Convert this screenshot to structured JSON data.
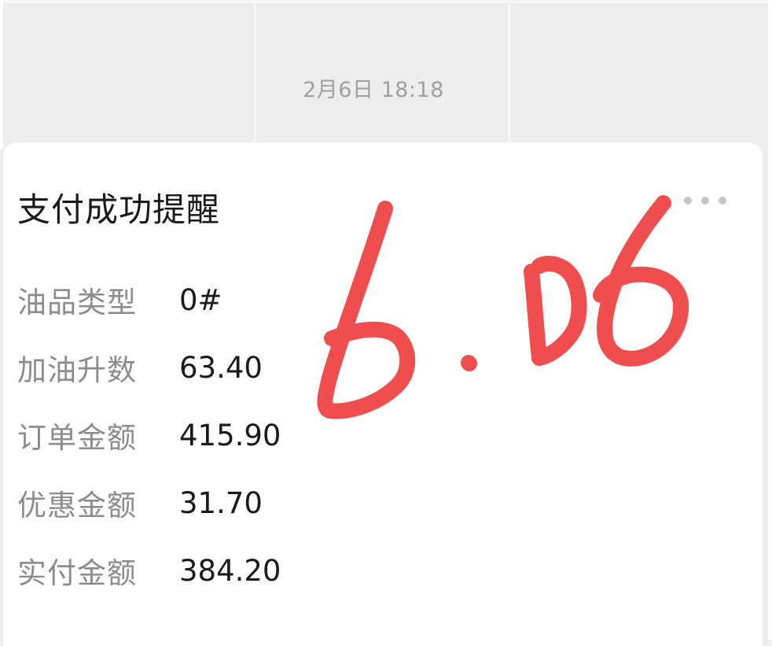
{
  "timestamp": "2月6日 18:18",
  "card": {
    "title": "支付成功提醒",
    "menu_icon": "more-horizontal-icon",
    "rows": [
      {
        "label": "油品类型",
        "value": "0#"
      },
      {
        "label": "加油升数",
        "value": "63.40"
      },
      {
        "label": "订单金额",
        "value": "415.90"
      },
      {
        "label": "优惠金额",
        "value": "31.70"
      },
      {
        "label": "实付金额",
        "value": "384.20"
      }
    ]
  },
  "handwritten_annotation": {
    "text": "6.06",
    "color": "#f04d4f"
  },
  "colors": {
    "background": "#ededed",
    "card": "#ffffff",
    "label": "#8c8c8c",
    "value": "#1a1a1a",
    "timestamp": "#a0a0a0"
  }
}
